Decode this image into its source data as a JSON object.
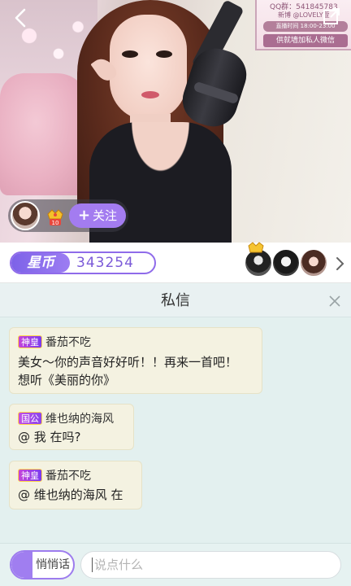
{
  "banner": {
    "qq": "QQ群：541845783",
    "weibo": "新博 @LOVELY萱",
    "time": "直播时间 18:00-23:00",
    "wechat": "供就墙加私人微信"
  },
  "host": {
    "level": "10",
    "follow_label": "关注",
    "follow_icon": "plus-icon"
  },
  "coins": {
    "label": "星币",
    "value": "343254"
  },
  "panel": {
    "title": "私信"
  },
  "messages": [
    {
      "badge": "神皇",
      "badge_color": "#8a3fe8",
      "sender": "番茄不吃",
      "line1": "美女～你的声音好好听！！再来一首吧！",
      "line2": "想听《美丽的你》"
    },
    {
      "badge": "国公",
      "badge_color": "#9a48ea",
      "sender": "维也纳的海风",
      "line1": "@ 我 在吗?"
    },
    {
      "badge": "神皇",
      "badge_color": "#8a3fe8",
      "sender": "番茄不吃",
      "line1": "@ 维也纳的海风  在"
    }
  ],
  "input": {
    "whisper_label": "悄悄话",
    "placeholder": "说点什么"
  },
  "colors": {
    "accent": "#9d7cee",
    "panel_bg": "#e3f0ef",
    "bubble_bg": "#f4f2e1"
  }
}
